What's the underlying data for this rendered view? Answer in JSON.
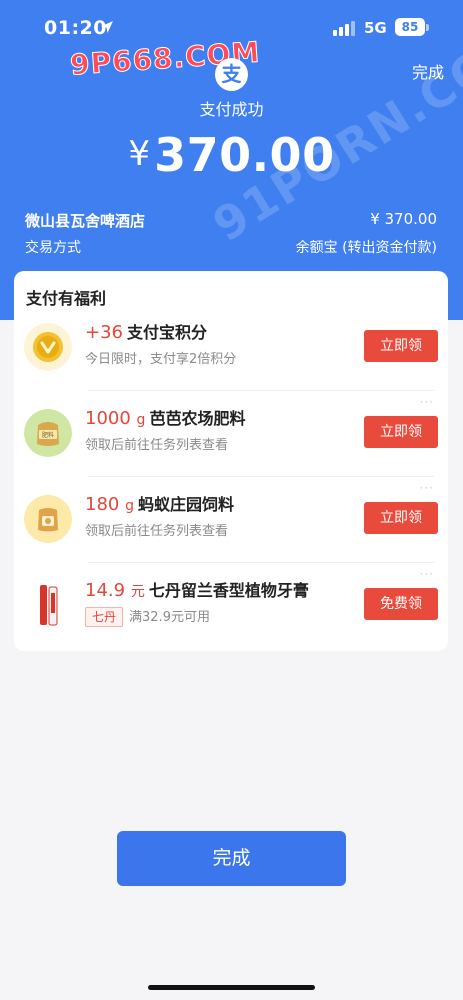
{
  "status_bar": {
    "time": "01:20",
    "network": "5G",
    "battery": "85"
  },
  "watermarks": [
    "9P668.COM",
    "91PORN.COM"
  ],
  "header": {
    "logo_char": "支",
    "done_label": "完成",
    "status_text": "支付成功",
    "currency": "¥",
    "amount": "370.00"
  },
  "details": {
    "merchant": "微山县瓦舍啤酒店",
    "merchant_amount": "¥ 370.00",
    "method_label": "交易方式",
    "method_value": "余额宝 (转出资金付款)"
  },
  "benefits": {
    "title": "支付有福利",
    "offers": [
      {
        "highlight": "+36",
        "unit": "",
        "name": "支付宝积分",
        "sub": "今日限时，支付享2倍积分",
        "button": "立即领",
        "icon": "alipay-points-coin-icon"
      },
      {
        "highlight": "1000",
        "unit": "g",
        "name": "芭芭农场肥料",
        "sub": "领取后前往任务列表查看",
        "button": "立即领",
        "icon": "fertilizer-bag-icon",
        "icon_text": "肥料"
      },
      {
        "highlight": "180",
        "unit": "g",
        "name": "蚂蚁庄园饲料",
        "sub": "领取后前往任务列表查看",
        "button": "立即领",
        "icon": "feed-bag-icon"
      },
      {
        "highlight": "14.9",
        "unit": "元",
        "name": "七丹留兰香型植物牙膏",
        "tag": "七丹",
        "sub": "满32.9元可用",
        "button": "免费领",
        "icon": "toothpaste-icon"
      }
    ],
    "more": "···"
  },
  "footer": {
    "done_label": "完成"
  },
  "colors": {
    "brand_blue": "#3f7ff0",
    "accent_red": "#e84a3c"
  }
}
